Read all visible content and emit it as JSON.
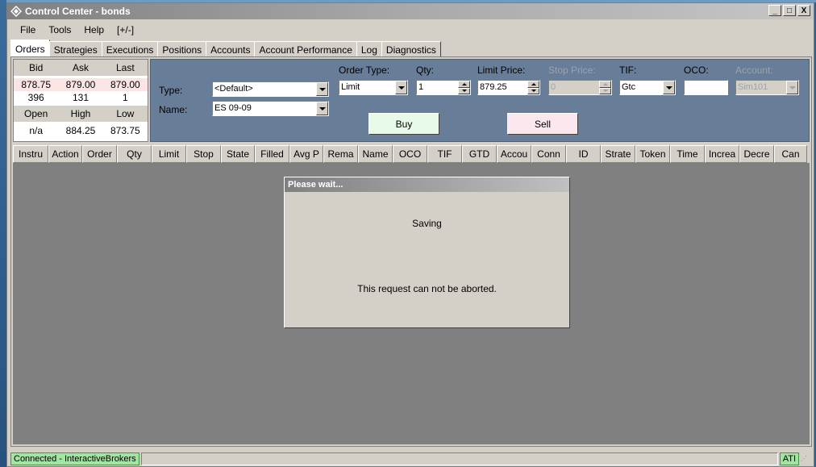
{
  "window": {
    "title": "Control Center - bonds",
    "minimize": "_",
    "maximize": "□",
    "close": "X"
  },
  "menu": [
    "File",
    "Tools",
    "Help",
    "[+/-]"
  ],
  "tabs": [
    "Orders",
    "Strategies",
    "Executions",
    "Positions",
    "Accounts",
    "Account Performance",
    "Log",
    "Diagnostics"
  ],
  "quote": {
    "headers1": [
      "Bid",
      "Ask",
      "Last"
    ],
    "row1": [
      "878.75",
      "879.00",
      "879.00"
    ],
    "row2": [
      "396",
      "131",
      "1"
    ],
    "headers2": [
      "Open",
      "High",
      "Low"
    ],
    "row3": [
      "n/a",
      "884.25",
      "873.75"
    ]
  },
  "order_form": {
    "type_label": "Type:",
    "type_value": "<Default>",
    "name_label": "Name:",
    "name_value": "ES 09-09",
    "order_type_label": "Order Type:",
    "order_type_value": "Limit",
    "qty_label": "Qty:",
    "qty_value": "1",
    "limit_label": "Limit Price:",
    "limit_value": "879.25",
    "stop_label": "Stop Price:",
    "stop_value": "0",
    "tif_label": "TIF:",
    "tif_value": "Gtc",
    "oco_label": "OCO:",
    "oco_value": "",
    "account_label": "Account:",
    "account_value": "Sim101",
    "buy": "Buy",
    "sell": "Sell"
  },
  "columns": [
    "Instru",
    "Action",
    "Order",
    "Qty",
    "Limit",
    "Stop",
    "State",
    "Filled",
    "Avg P",
    "Rema",
    "Name",
    "OCO",
    "TIF",
    "GTD",
    "Accou",
    "Conn",
    "ID",
    "Strate",
    "Token",
    "Time",
    "Increa",
    "Decre",
    "Can"
  ],
  "dialog": {
    "title": "Please wait...",
    "message": "Saving",
    "note": "This request can not be aborted."
  },
  "status": {
    "connection": "Connected - InteractiveBrokers",
    "ati": "ATI"
  },
  "colors": {
    "order_panel": "#687d97",
    "buy": "#e8fbe8",
    "sell": "#fbe8ee",
    "connected": "#a3e4a3"
  }
}
